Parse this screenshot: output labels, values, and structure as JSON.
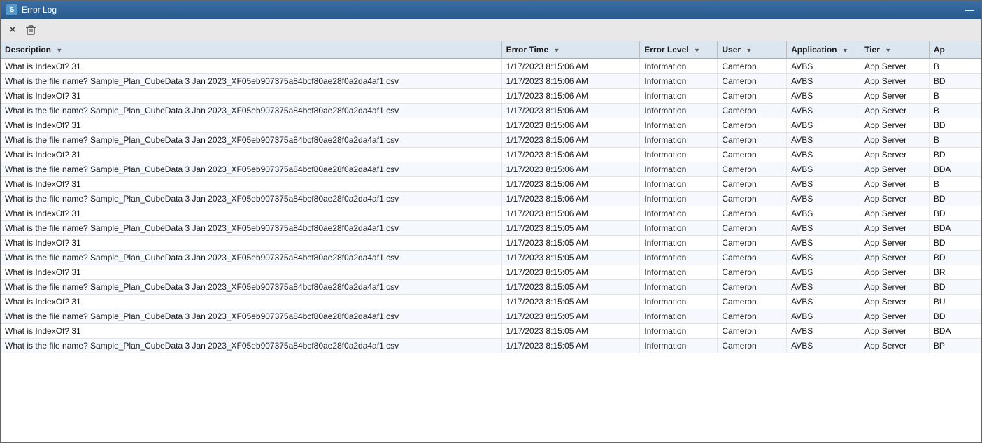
{
  "window": {
    "title": "Error Log",
    "icon": "S"
  },
  "toolbar": {
    "close_btn": "✕",
    "delete_btn": "🗑"
  },
  "table": {
    "columns": [
      {
        "id": "description",
        "label": "Description",
        "has_filter": true
      },
      {
        "id": "error_time",
        "label": "Error Time",
        "has_filter": true
      },
      {
        "id": "error_level",
        "label": "Error Level",
        "has_filter": true
      },
      {
        "id": "user",
        "label": "User",
        "has_filter": true
      },
      {
        "id": "application",
        "label": "Application",
        "has_filter": true
      },
      {
        "id": "tier",
        "label": "Tier",
        "has_filter": true
      },
      {
        "id": "app",
        "label": "Ap",
        "has_filter": false
      }
    ],
    "rows": [
      {
        "description": "What is IndexOf? 31",
        "error_time": "1/17/2023 8:15:06 AM",
        "error_level": "Information",
        "user": "Cameron",
        "application": "AVBS",
        "tier": "App Server",
        "app": "B"
      },
      {
        "description": "What is the file name? Sample_Plan_CubeData 3 Jan 2023_XF05eb907375a84bcf80ae28f0a2da4af1.csv",
        "error_time": "1/17/2023 8:15:06 AM",
        "error_level": "Information",
        "user": "Cameron",
        "application": "AVBS",
        "tier": "App Server",
        "app": "BD"
      },
      {
        "description": "What is IndexOf? 31",
        "error_time": "1/17/2023 8:15:06 AM",
        "error_level": "Information",
        "user": "Cameron",
        "application": "AVBS",
        "tier": "App Server",
        "app": "B"
      },
      {
        "description": "What is the file name? Sample_Plan_CubeData 3 Jan 2023_XF05eb907375a84bcf80ae28f0a2da4af1.csv",
        "error_time": "1/17/2023 8:15:06 AM",
        "error_level": "Information",
        "user": "Cameron",
        "application": "AVBS",
        "tier": "App Server",
        "app": "B"
      },
      {
        "description": "What is IndexOf? 31",
        "error_time": "1/17/2023 8:15:06 AM",
        "error_level": "Information",
        "user": "Cameron",
        "application": "AVBS",
        "tier": "App Server",
        "app": "BD"
      },
      {
        "description": "What is the file name? Sample_Plan_CubeData 3 Jan 2023_XF05eb907375a84bcf80ae28f0a2da4af1.csv",
        "error_time": "1/17/2023 8:15:06 AM",
        "error_level": "Information",
        "user": "Cameron",
        "application": "AVBS",
        "tier": "App Server",
        "app": "B"
      },
      {
        "description": "What is IndexOf? 31",
        "error_time": "1/17/2023 8:15:06 AM",
        "error_level": "Information",
        "user": "Cameron",
        "application": "AVBS",
        "tier": "App Server",
        "app": "BD"
      },
      {
        "description": "What is the file name? Sample_Plan_CubeData 3 Jan 2023_XF05eb907375a84bcf80ae28f0a2da4af1.csv",
        "error_time": "1/17/2023 8:15:06 AM",
        "error_level": "Information",
        "user": "Cameron",
        "application": "AVBS",
        "tier": "App Server",
        "app": "BDA"
      },
      {
        "description": "What is IndexOf? 31",
        "error_time": "1/17/2023 8:15:06 AM",
        "error_level": "Information",
        "user": "Cameron",
        "application": "AVBS",
        "tier": "App Server",
        "app": "B"
      },
      {
        "description": "What is the file name? Sample_Plan_CubeData 3 Jan 2023_XF05eb907375a84bcf80ae28f0a2da4af1.csv",
        "error_time": "1/17/2023 8:15:06 AM",
        "error_level": "Information",
        "user": "Cameron",
        "application": "AVBS",
        "tier": "App Server",
        "app": "BD"
      },
      {
        "description": "What is IndexOf? 31",
        "error_time": "1/17/2023 8:15:06 AM",
        "error_level": "Information",
        "user": "Cameron",
        "application": "AVBS",
        "tier": "App Server",
        "app": "BD"
      },
      {
        "description": "What is the file name? Sample_Plan_CubeData 3 Jan 2023_XF05eb907375a84bcf80ae28f0a2da4af1.csv",
        "error_time": "1/17/2023 8:15:05 AM",
        "error_level": "Information",
        "user": "Cameron",
        "application": "AVBS",
        "tier": "App Server",
        "app": "BDA"
      },
      {
        "description": "What is IndexOf? 31",
        "error_time": "1/17/2023 8:15:05 AM",
        "error_level": "Information",
        "user": "Cameron",
        "application": "AVBS",
        "tier": "App Server",
        "app": "BD"
      },
      {
        "description": "What is the file name? Sample_Plan_CubeData 3 Jan 2023_XF05eb907375a84bcf80ae28f0a2da4af1.csv",
        "error_time": "1/17/2023 8:15:05 AM",
        "error_level": "Information",
        "user": "Cameron",
        "application": "AVBS",
        "tier": "App Server",
        "app": "BD"
      },
      {
        "description": "What is IndexOf? 31",
        "error_time": "1/17/2023 8:15:05 AM",
        "error_level": "Information",
        "user": "Cameron",
        "application": "AVBS",
        "tier": "App Server",
        "app": "BR"
      },
      {
        "description": "What is the file name? Sample_Plan_CubeData 3 Jan 2023_XF05eb907375a84bcf80ae28f0a2da4af1.csv",
        "error_time": "1/17/2023 8:15:05 AM",
        "error_level": "Information",
        "user": "Cameron",
        "application": "AVBS",
        "tier": "App Server",
        "app": "BD"
      },
      {
        "description": "What is IndexOf? 31",
        "error_time": "1/17/2023 8:15:05 AM",
        "error_level": "Information",
        "user": "Cameron",
        "application": "AVBS",
        "tier": "App Server",
        "app": "BU"
      },
      {
        "description": "What is the file name? Sample_Plan_CubeData 3 Jan 2023_XF05eb907375a84bcf80ae28f0a2da4af1.csv",
        "error_time": "1/17/2023 8:15:05 AM",
        "error_level": "Information",
        "user": "Cameron",
        "application": "AVBS",
        "tier": "App Server",
        "app": "BD"
      },
      {
        "description": "What is IndexOf? 31",
        "error_time": "1/17/2023 8:15:05 AM",
        "error_level": "Information",
        "user": "Cameron",
        "application": "AVBS",
        "tier": "App Server",
        "app": "BDA"
      },
      {
        "description": "What is the file name? Sample_Plan_CubeData 3 Jan 2023_XF05eb907375a84bcf80ae28f0a2da4af1.csv",
        "error_time": "1/17/2023 8:15:05 AM",
        "error_level": "Information",
        "user": "Cameron",
        "application": "AVBS",
        "tier": "App Server",
        "app": "BP"
      }
    ]
  }
}
